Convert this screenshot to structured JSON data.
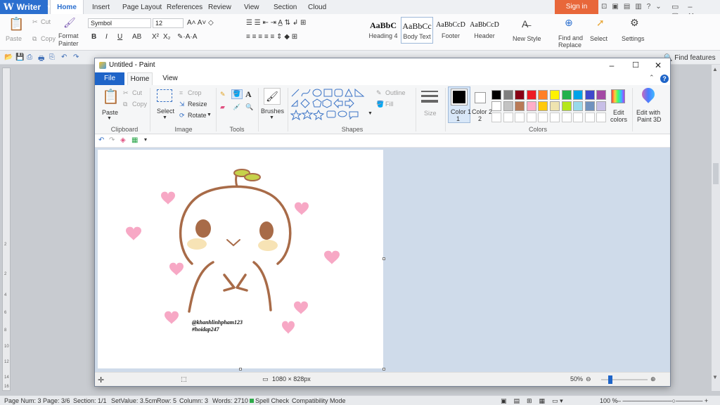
{
  "writer": {
    "app_name": "Writer",
    "tabs": [
      "Home",
      "Insert",
      "Page Layout",
      "References",
      "Review",
      "View",
      "Section",
      "Cloud"
    ],
    "sign_in": "Sign in",
    "font_name": "Symbol",
    "font_size": "12",
    "clipboard": {
      "paste": "Paste",
      "cut": "Cut",
      "copy": "Copy",
      "format_painter_1": "Format",
      "format_painter_2": "Painter"
    },
    "styles": [
      {
        "preview": "AaBbC",
        "name": "Heading 4"
      },
      {
        "preview": "AaBbCc",
        "name": "Body Text"
      },
      {
        "preview": "AaBbCcD",
        "name": "Footer"
      },
      {
        "preview": "AaBbCcD",
        "name": "Header"
      }
    ],
    "new_style": "New Style",
    "find_replace_1": "Find and",
    "find_replace_2": "Replace",
    "select": "Select",
    "settings": "Settings",
    "find_features": "Find features",
    "status": {
      "page_num": "Page Num: 3",
      "page": "Page: 3/6",
      "section": "Section: 1/1",
      "set_value": "SetValue: 3.5cm",
      "row": "Row: 5",
      "column": "Column: 3",
      "words": "Words: 2710",
      "spell_check": "Spell Check",
      "compat": "Compatibility Mode",
      "zoom": "100 %"
    },
    "ruler_numbers": [
      "2",
      "2",
      "4",
      "6",
      "8",
      "10",
      "12",
      "14",
      "16"
    ]
  },
  "paint": {
    "title": "Untitled - Paint",
    "tabs": {
      "file": "File",
      "home": "Home",
      "view": "View"
    },
    "clipboard": {
      "paste": "Paste",
      "cut": "Cut",
      "copy": "Copy",
      "label": "Clipboard"
    },
    "image": {
      "select": "Select",
      "crop": "Crop",
      "resize": "Resize",
      "rotate": "Rotate",
      "label": "Image"
    },
    "tools": {
      "label": "Tools",
      "text_tool": "A"
    },
    "brushes": "Brushes",
    "shapes": {
      "outline": "Outline",
      "fill": "Fill",
      "label": "Shapes"
    },
    "size": "Size",
    "color1": "Color 1",
    "color1_num": "1",
    "color2": "Color 2",
    "color2_num": "2",
    "colors_label": "Colors",
    "edit_colors_1": "Edit",
    "edit_colors_2": "colors",
    "paint3d_1": "Edit with",
    "paint3d_2": "Paint 3D",
    "palette_row1": [
      "#000000",
      "#7f7f7f",
      "#880015",
      "#ed1c24",
      "#ff7f27",
      "#fff200",
      "#22b14c",
      "#00a2e8",
      "#3f48cc",
      "#a349a4"
    ],
    "palette_row2": [
      "#ffffff",
      "#c3c3c3",
      "#b97a57",
      "#ffaec9",
      "#ffc90e",
      "#efe4b0",
      "#b5e61d",
      "#99d9ea",
      "#7092be",
      "#c8bfe7"
    ],
    "status": {
      "dimensions": "1080 × 828px",
      "zoom": "50%"
    },
    "canvas_text": {
      "line1": "@khanhlinhpham123",
      "line2": "#hoidap247"
    },
    "drawing_colors": {
      "outline": "#a86b48",
      "cheek": "#f7e3b5",
      "heart": "#f7a8c5",
      "sprout": "#c6d24a"
    }
  }
}
